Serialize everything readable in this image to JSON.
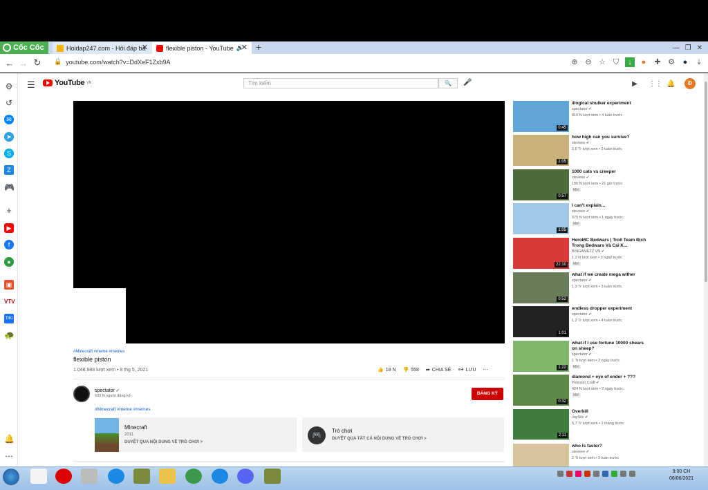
{
  "browser": {
    "brand": "Cốc Cốc",
    "tabs": [
      {
        "label": "Hoidap247.com - Hỏi đáp bà",
        "active": false
      },
      {
        "label": "flexible piston - YouTube",
        "active": true
      }
    ],
    "url": "youtube.com/watch?v=DdXeF1Zxb9A"
  },
  "youtube": {
    "logo_text": "YouTube",
    "region": "VN",
    "search_placeholder": "Tìm kiếm",
    "avatar_letter": "Đ"
  },
  "video": {
    "hashtags": "#Minecraft #meme #memes",
    "title": "flexible piston",
    "meta": "1.048.988 lượt xem • 8 thg 5, 2021",
    "likes": "18 N",
    "dislikes": "558",
    "share_label": "CHIA SẺ",
    "save_label": "LƯU"
  },
  "channel": {
    "name": "spectator",
    "subscribers": "633 N người đăng ký",
    "subscribe_label": "ĐĂNG KÝ",
    "tags": "#Minecraft #meme #memes"
  },
  "cards": [
    {
      "title": "Minecraft",
      "year": "2011",
      "link": "DUYỆT QUA NỘI DUNG VỀ TRÒ CHƠI >"
    },
    {
      "title": "Trò chơi",
      "link": "DUYỆT QUA TẤT CẢ NỘI DUNG VỀ TRÒ CHƠI >"
    }
  ],
  "related": [
    {
      "title": "illogical shulker experiment",
      "channel": "spectator",
      "meta": "810 N lượt xem • 4 tuần trước",
      "duration": "0:45",
      "badge": "",
      "color": "#5fa5d8"
    },
    {
      "title": "how high can you survive?",
      "channel": "steveee",
      "meta": "2,6 Tr lượt xem • 2 tuần trước",
      "duration": "1:05",
      "badge": "",
      "color": "#c9b27a"
    },
    {
      "title": "1000 cats vs creeper",
      "channel": "steveee",
      "meta": "185 N lượt xem • 21 giờ trước",
      "duration": "0:57",
      "badge": "Mới",
      "color": "#4e6b3a"
    },
    {
      "title": "I can't explain...",
      "channel": "steveee",
      "meta": "575 N lượt xem • 1 ngày trước",
      "duration": "1:05",
      "badge": "Mới",
      "color": "#9fc8e8"
    },
    {
      "title": "HeroMC Bedwars | Troll Team Địch Trong Bedwars Và Cái K...",
      "channel": "BINGAMEZZ VN",
      "meta": "1,2 N lượt xem • 3 ngày trước",
      "duration": "22:10",
      "badge": "Mới",
      "color": "#d83a3a"
    },
    {
      "title": "what if we create mega wither",
      "channel": "spectator",
      "meta": "1,3 Tr lượt xem • 3 tuần trước",
      "duration": "0:52",
      "badge": "",
      "color": "#6a7d5a"
    },
    {
      "title": "endless dropper experiment",
      "channel": "spectator",
      "meta": "1,2 Tr lượt xem • 4 tuần trước",
      "duration": "1:01",
      "badge": "",
      "color": "#222222"
    },
    {
      "title": "what if I use fortune 10000 shears on sheep?",
      "channel": "spectator",
      "meta": "1 Tr lượt xem • 2 ngày trước",
      "duration": "1:22",
      "badge": "Mới",
      "color": "#7fb86a"
    },
    {
      "title": "diamond + eye of ender + ???",
      "channel": "Peteson Craft",
      "meta": "424 N lượt xem • 2 ngày trước",
      "duration": "0:32",
      "badge": "Mới",
      "color": "#5a8a45"
    },
    {
      "title": "Overkill",
      "channel": "JaySilv",
      "meta": "5,7 Tr lượt xem • 1 tháng trước",
      "duration": "2:11",
      "badge": "",
      "color": "#3e7d3e"
    },
    {
      "title": "who is faster?",
      "channel": "steveee",
      "meta": "2 Tr lượt xem • 3 tuần trước",
      "duration": "",
      "badge": "",
      "color": "#d8c49a"
    }
  ],
  "taskbar": {
    "time": "9:00 CH",
    "date": "06/06/2021"
  }
}
